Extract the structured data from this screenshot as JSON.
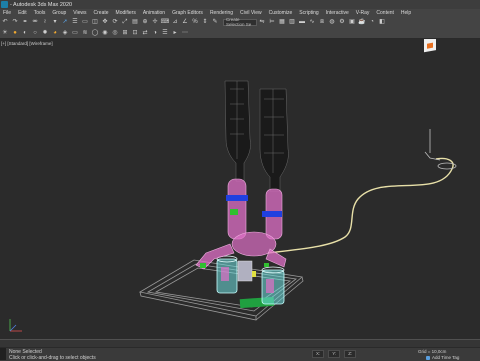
{
  "window": {
    "title": "- Autodesk 3ds Max 2020"
  },
  "menu": {
    "items": [
      "File",
      "Edit",
      "Tools",
      "Group",
      "Views",
      "Create",
      "Modifiers",
      "Animation",
      "Graph Editors",
      "Rendering",
      "Civil View",
      "Customize",
      "Scripting",
      "Interactive",
      "V-Ray",
      "Content",
      "Help"
    ]
  },
  "toolbar": {
    "selection_set_placeholder": "Create Selection Se"
  },
  "viewport": {
    "label": "[+] [Standard] [Wireframe]"
  },
  "status": {
    "selection": "None Selected",
    "hint": "Click or click-and-drag to select objects",
    "x_label": "X:",
    "y_label": "Y:",
    "z_label": "Z:",
    "grid": "Grid = 10,0cm",
    "add_time_tag": "Add Time Tag"
  },
  "colors": {
    "background": "#2b2b2b",
    "ui_panel": "#444444",
    "accent_orange": "#f0a830",
    "bottle_dark": "#1a1a1a",
    "cable_yellow": "#e8e0a8",
    "robot_pink": "#e070c8",
    "glass_cyan": "#70e0e0",
    "green_pad": "#20a040"
  }
}
